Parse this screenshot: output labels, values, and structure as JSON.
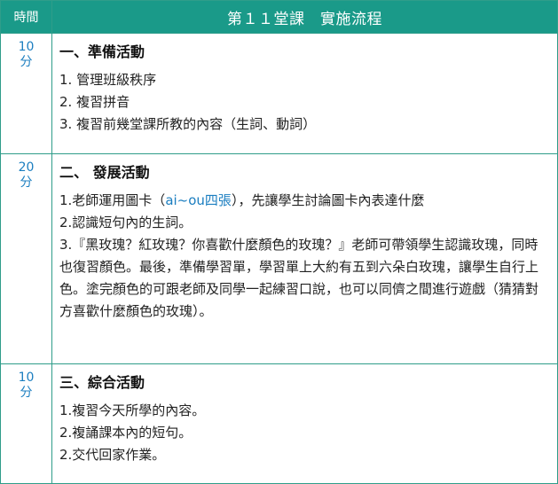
{
  "header": {
    "time_label": "時間",
    "title": "第１１堂課　實施流程"
  },
  "sections": [
    {
      "time_number": "10",
      "time_unit": "分",
      "title": "一、準備活動",
      "items": [
        "1. 管理班級秩序",
        "2. 複習拼音",
        "3. 複習前幾堂課所教的內容（生詞、動詞）"
      ]
    },
    {
      "time_number": "20",
      "time_unit": "分",
      "title": "二、 發展活動",
      "item1_prefix": "1.老師運用圖卡（",
      "item1_highlight": "ai~ou四張",
      "item1_suffix": "），先讓學生討論圖卡內表達什麼",
      "items": [
        "2.認識短句內的生詞。",
        "3.『黑玫瑰？紅玫瑰？你喜歡什麼顏色的玫瑰？』老師可帶領學生認識玫瑰，同時也復習顏色。最後，準備學習單，學習單上大約有五到六朵白玫瑰，讓學生自行上色。塗完顏色的可跟老師及同學一起練習口說，也可以同儕之間進行遊戲（猜猜對方喜歡什麼顏色的玫瑰）。"
      ]
    },
    {
      "time_number": "10",
      "time_unit": "分",
      "title": "三、綜合活動",
      "items": [
        "1.複習今天所學的內容。",
        "2.複誦課本內的短句。",
        "2.交代回家作業。"
      ]
    }
  ],
  "colors": {
    "header_bg": "#1a9a89",
    "border": "#2f9d8a",
    "time_text": "#1b7ec0",
    "highlight": "#1b7ec0"
  }
}
